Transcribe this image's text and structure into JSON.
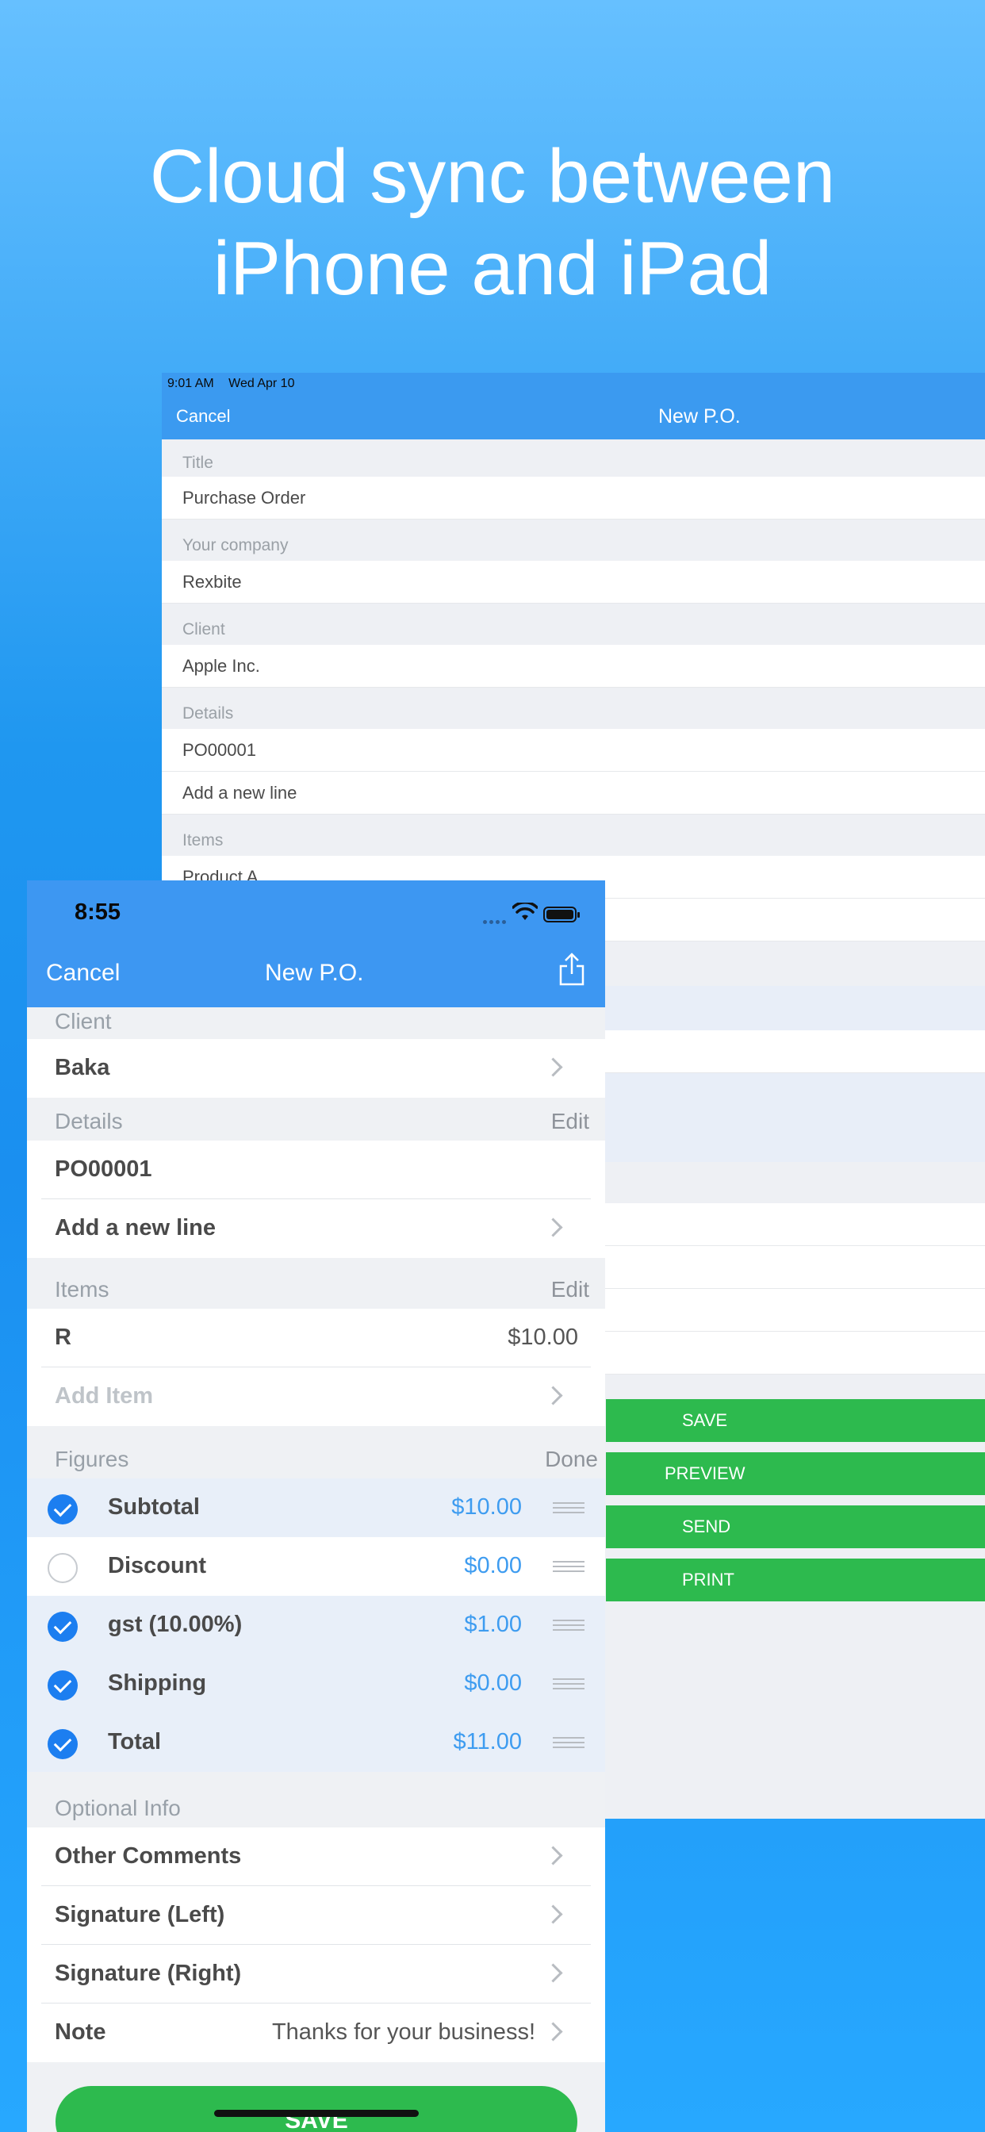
{
  "headline": {
    "line1": "Cloud sync between",
    "line2": "iPhone and iPad"
  },
  "ipad": {
    "status_time": "9:01 AM",
    "status_date": "Wed Apr 10",
    "nav_cancel": "Cancel",
    "nav_title": "New P.O.",
    "sections": {
      "title_header": "Title",
      "title_value": "Purchase Order",
      "company_header": "Your company",
      "company_value": "Rexbite",
      "client_header": "Client",
      "client_value": "Apple Inc.",
      "details_header": "Details",
      "details_po": "PO00001",
      "details_add_line": "Add a new line",
      "items_header": "Items",
      "items_first": "Product A"
    },
    "actions": {
      "save": "SAVE",
      "preview": "PREVIEW",
      "send": "SEND",
      "print": "PRINT"
    }
  },
  "iphone": {
    "status_time": "8:55",
    "nav_cancel": "Cancel",
    "nav_title": "New P.O.",
    "share_icon": "share-icon",
    "client": {
      "header": "Client",
      "value": "Baka"
    },
    "details": {
      "header": "Details",
      "edit": "Edit",
      "po": "PO00001",
      "add_line": "Add a new line"
    },
    "items": {
      "header": "Items",
      "edit": "Edit",
      "rows": [
        {
          "name": "R",
          "amount": "$10.00"
        }
      ],
      "add_item": "Add Item"
    },
    "figures": {
      "header": "Figures",
      "done": "Done",
      "rows": [
        {
          "label": "Subtotal",
          "amount": "$10.00",
          "checked": true
        },
        {
          "label": "Discount",
          "amount": "$0.00",
          "checked": false
        },
        {
          "label": "gst (10.00%)",
          "amount": "$1.00",
          "checked": true
        },
        {
          "label": "Shipping",
          "amount": "$0.00",
          "checked": true
        },
        {
          "label": "Total",
          "amount": "$11.00",
          "checked": true
        }
      ]
    },
    "optional": {
      "header": "Optional Info",
      "other_comments": "Other Comments",
      "signature_left": "Signature (Left)",
      "signature_right": "Signature (Right)",
      "note_label": "Note",
      "note_value": "Thanks for your business!"
    },
    "save_button": "SAVE"
  },
  "colors": {
    "nav_blue": "#3d97f2",
    "action_green": "#2dba4e",
    "figure_amount_blue": "#3e9cf0",
    "check_blue": "#1c7ef0"
  }
}
